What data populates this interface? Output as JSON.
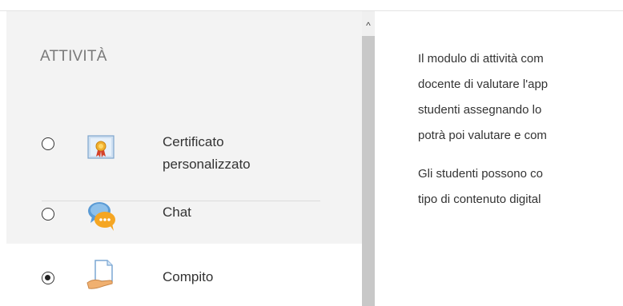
{
  "section": {
    "title": "ATTIVITÀ"
  },
  "activities": [
    {
      "label_line1": "Certificato",
      "label_line2": "personalizzato",
      "selected": false,
      "icon": "certificate-icon"
    },
    {
      "label": "Chat",
      "selected": false,
      "icon": "chat-icon"
    },
    {
      "label": "Compito",
      "selected": true,
      "icon": "assignment-icon"
    }
  ],
  "description": {
    "p1": [
      "Il modulo di attività com",
      "docente di valutare l'app",
      "studenti assegnando lo",
      "potrà poi valutare e com"
    ],
    "p2": [
      "Gli studenti possono co",
      "tipo di contenuto digital"
    ]
  },
  "scrollbar": {
    "up_arrow": "^"
  }
}
